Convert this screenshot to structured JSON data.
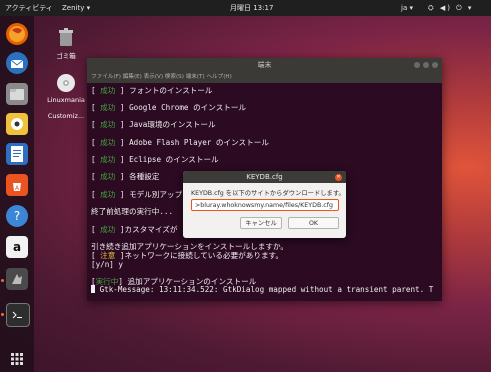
{
  "topbar": {
    "activities": "アクティビティ",
    "app_menu": "Zenity ▾",
    "clock": "月曜日 13:17",
    "language": "ja ▾",
    "tray": "⛭ ◀) ⏻ ▾"
  },
  "dock": {
    "items": [
      {
        "name": "firefox-icon",
        "color": "#e66000"
      },
      {
        "name": "thunderbird-icon",
        "color": "#2a72c0"
      },
      {
        "name": "files-icon",
        "color": "#8a8a8a"
      },
      {
        "name": "rhythmbox-icon",
        "color": "#f0c23b"
      },
      {
        "name": "writer-icon",
        "color": "#2f6fc1"
      },
      {
        "name": "software-center-icon",
        "color": "#e95420"
      },
      {
        "name": "help-icon",
        "color": "#3c86d6"
      },
      {
        "name": "amazon-icon",
        "color": "#f2f2f2"
      },
      {
        "name": "zenity-icon",
        "color": "#4a4a4a"
      },
      {
        "name": "terminal-icon",
        "color": "#2e2e2e"
      }
    ],
    "show_apps_icon": "grid-icon"
  },
  "desktop": {
    "icons": [
      {
        "label": "ゴミ箱"
      },
      {
        "label": "Linuxmania"
      },
      {
        "label": "Customiz..."
      }
    ]
  },
  "terminal": {
    "title": "端末",
    "menu": [
      "ファイル(F)",
      "編集(E)",
      "表示(V)",
      "検索(S)",
      "端末(T)",
      "ヘルプ(H)"
    ],
    "lines": [
      {
        "status": "成功",
        "text": "フォントのインストール"
      },
      {
        "status": "成功",
        "text": "Google Chrome のインストール"
      },
      {
        "status": "成功",
        "text": "Java環境のインストール"
      },
      {
        "status": "成功",
        "text": "Adobe Flash Player のインストール"
      },
      {
        "status": "成功",
        "text": "Eclipse のインストール"
      },
      {
        "status": "成功",
        "text": "各種設定"
      },
      {
        "status": "成功",
        "text": "モデル別アップ"
      }
    ],
    "line_finish": "終了前処理の実行中...",
    "line_custom_status": "成功",
    "line_custom_text": "カスタマイズが",
    "line_continue": "引き続き追加アプリケーションをインストールしますか。",
    "line_note_label": "注意",
    "line_note_text": "ネットワークに接続している必要があります。",
    "line_prompt": "[y/n] y",
    "line_run_label": "実行中",
    "line_run_text": "追加アプリケーションのインストール",
    "line_gtk": "Gtk-Message: 13:11:34.522: GtkDialog mapped without a transient parent. T"
  },
  "dialog": {
    "title": "KEYDB.cfg",
    "message": "KEYDB.cfg を以下のサイトからダウンロードします。",
    "url_value": ">bluray.whoknowsmy.name/files/KEYDB.cfg",
    "cancel_label": "キャンセル",
    "ok_label": "OK"
  }
}
